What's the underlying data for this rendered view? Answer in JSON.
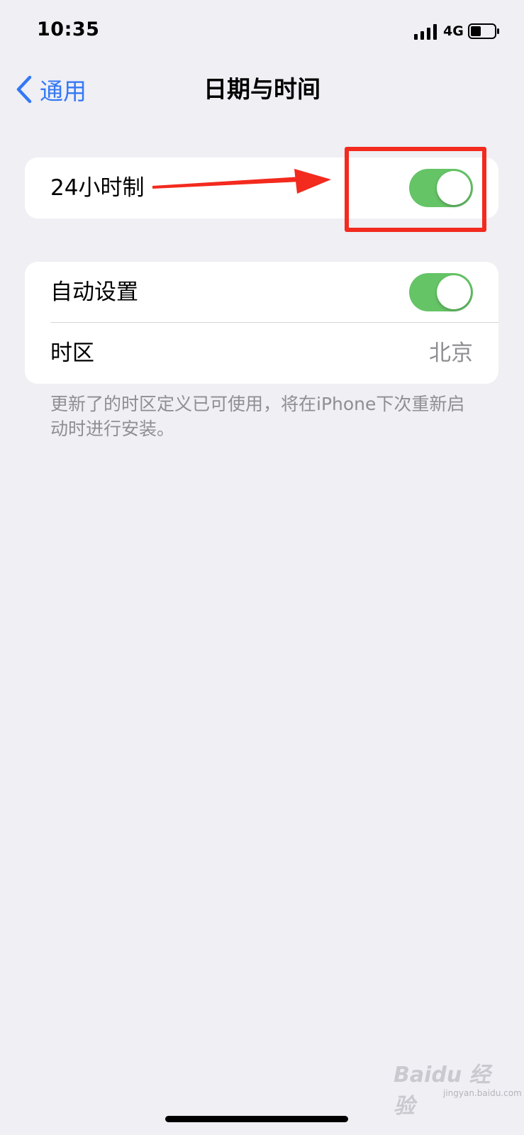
{
  "status_bar": {
    "time": "10:35",
    "network": "4G",
    "signal_icon": "cellular-signal-icon",
    "battery_icon": "battery-icon"
  },
  "nav": {
    "back_label": "通用",
    "back_icon": "chevron-left-icon",
    "title": "日期与时间"
  },
  "settings": {
    "hour24": {
      "label": "24小时制",
      "enabled": true
    },
    "auto_set": {
      "label": "自动设置",
      "enabled": true
    },
    "timezone": {
      "label": "时区",
      "value": "北京"
    }
  },
  "footnote": "更新了的时区定义已可使用，将在iPhone下次重新启动时进行安装。",
  "watermark": {
    "brand": "Baidu 经验",
    "url": "jingyan.baidu.com"
  },
  "colors": {
    "accent": "#3478f6",
    "toggle_on": "#65c466",
    "annotation": "#f32a1e",
    "background": "#efeff4",
    "secondary_text": "#8e8e93"
  }
}
